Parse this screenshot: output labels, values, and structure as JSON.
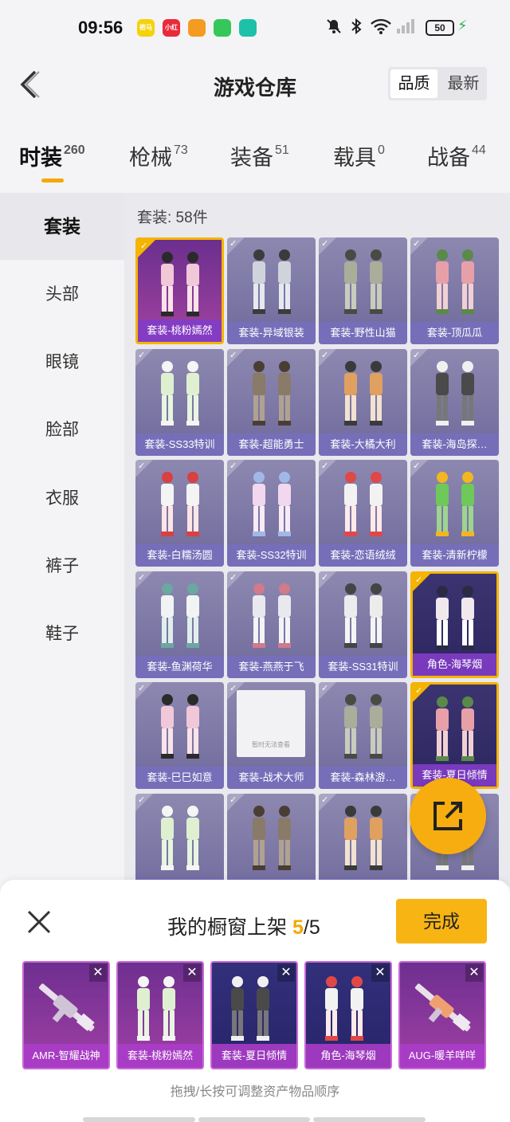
{
  "status_bar": {
    "time": "09:56",
    "apps": [
      {
        "icon": "miyou-app-icon",
        "text": "密马",
        "color": "#f5d20a"
      },
      {
        "icon": "xiaohongshu-app-icon",
        "text": "小红书",
        "color": "#ea2a3a"
      },
      {
        "icon": "taobao-app-icon",
        "text": "",
        "color": "#f49b22"
      },
      {
        "icon": "messages-app-icon",
        "text": "",
        "color": "#35c759"
      },
      {
        "icon": "chat-app-icon",
        "text": "",
        "color": "#1dc0a8"
      }
    ],
    "battery": "50"
  },
  "header": {
    "title": "游戏仓库",
    "sort_options": [
      "品质",
      "最新"
    ],
    "sort_selected": "品质"
  },
  "tabs": [
    {
      "label": "时装",
      "count": "260",
      "active": true
    },
    {
      "label": "枪械",
      "count": "73"
    },
    {
      "label": "装备",
      "count": "51"
    },
    {
      "label": "载具",
      "count": "0"
    },
    {
      "label": "战备",
      "count": "44"
    }
  ],
  "sidebar": {
    "items": [
      "套装",
      "头部",
      "眼镜",
      "脸部",
      "衣服",
      "裤子",
      "鞋子"
    ],
    "active": "套装"
  },
  "content": {
    "count_label": "套装: 58件",
    "items": [
      {
        "label": "套装-桃粉嫣然",
        "selected": true,
        "style": "pink"
      },
      {
        "label": "套装-异域银装"
      },
      {
        "label": "套装-野性山猫"
      },
      {
        "label": "套装-顶瓜瓜"
      },
      {
        "label": "套装-SS33特训"
      },
      {
        "label": "套装-超能勇士"
      },
      {
        "label": "套装-大橘大利"
      },
      {
        "label": "套装-海岛探…"
      },
      {
        "label": "套装-白糯汤圆"
      },
      {
        "label": "套装-SS32特训"
      },
      {
        "label": "套装-恋语绒绒"
      },
      {
        "label": "套装-清新柠檬"
      },
      {
        "label": "套装-鱼渊荷华"
      },
      {
        "label": "套装-燕燕于飞"
      },
      {
        "label": "套装-SS31特训"
      },
      {
        "label": "角色-海琴烟",
        "selected": true,
        "style": "blue"
      },
      {
        "label": "套装-巳巳如意"
      },
      {
        "label": "套装-战术大师",
        "placeholder": "暂时无法查看"
      },
      {
        "label": "套装-森林游…"
      },
      {
        "label": "套装-夏日倾情",
        "selected": true,
        "style": "blue"
      },
      {
        "label": ""
      },
      {
        "label": ""
      },
      {
        "label": ""
      },
      {
        "label": ""
      }
    ]
  },
  "panel": {
    "title": "我的橱窗上架",
    "current": "5",
    "total": "/5",
    "done_label": "完成",
    "shelf": [
      {
        "label": "AMR-智耀战神",
        "style": "pink"
      },
      {
        "label": "套装-桃粉嫣然",
        "style": "pink"
      },
      {
        "label": "套装-夏日倾情",
        "style": "blue"
      },
      {
        "label": "角色-海琴烟",
        "style": "blue"
      },
      {
        "label": "AUG-暖羊咩咩",
        "style": "pink"
      }
    ],
    "remove_symbol": "✕",
    "hint": "拖拽/长按可调整资产物品顺序"
  }
}
